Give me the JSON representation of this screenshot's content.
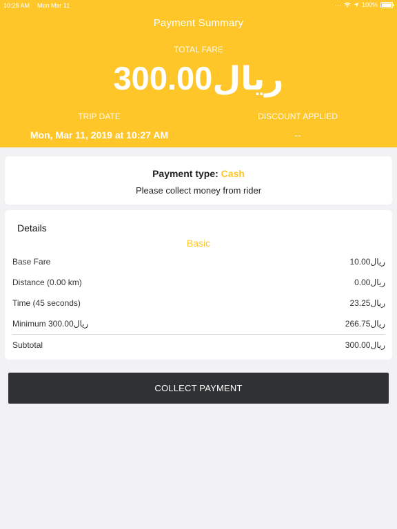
{
  "status_bar": {
    "time": "10:28 AM",
    "date": "Mon Mar 11",
    "battery": "100%"
  },
  "header": {
    "title": "Payment Summary",
    "total_fare_label": "TOTAL FARE",
    "total_fare_value": "300.00ريال",
    "trip_date_label": "TRIP DATE",
    "trip_date_value": "Mon, Mar 11, 2019 at 10:27 AM",
    "discount_label": "DISCOUNT APPLIED",
    "discount_value": "--"
  },
  "payment": {
    "type_label": "Payment type:",
    "type_value": "Cash",
    "note": "Please collect money from rider"
  },
  "details": {
    "title": "Details",
    "category": "Basic",
    "rows": [
      {
        "label": "Base Fare",
        "value": "10.00ريال"
      },
      {
        "label": "Distance (0.00 km)",
        "value": "0.00ريال"
      },
      {
        "label": "Time (45 seconds)",
        "value": "23.25ريال"
      },
      {
        "label": "Minimum 300.00ريال",
        "value": "266.75ريال"
      }
    ],
    "subtotal_label": "Subtotal",
    "subtotal_value": "300.00ريال"
  },
  "actions": {
    "collect_label": "COLLECT PAYMENT"
  },
  "colors": {
    "accent": "#ffc629",
    "button": "#2f3133",
    "background": "#f2f2f4"
  },
  "icons": [
    "wifi-icon",
    "location-icon",
    "battery-icon"
  ]
}
